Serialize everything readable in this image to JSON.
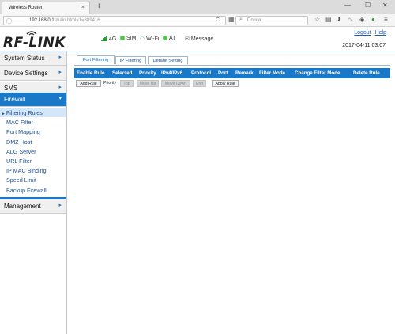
{
  "browser": {
    "tab_title": "Wireless Router",
    "tab_close": "×",
    "new_tab": "+",
    "win_min": "—",
    "win_max": "☐",
    "win_close": "✕",
    "url_host": "192.168.0.1",
    "url_rest": "/main.html#1=389416",
    "reload": "C",
    "search_placeholder": "Пошук",
    "icons": [
      "star-icon",
      "reading-list-icon",
      "download-icon",
      "home-icon",
      "pocket-icon",
      "extension-icon",
      "menu-icon"
    ]
  },
  "header": {
    "logo": "RF-LINK",
    "status": {
      "net": "4G",
      "sim": "SIM",
      "wifi": "Wi-Fi",
      "at": "AT",
      "message": "Message"
    },
    "links": {
      "logout": "Logout",
      "help": "Help"
    },
    "datetime": "2017-04-11 03:07",
    "colors": {
      "accent": "#1a78c8",
      "status_green": "#4cc94c"
    }
  },
  "sidebar": {
    "menus": [
      {
        "label": "System Status"
      },
      {
        "label": "Device Settings"
      },
      {
        "label": "SMS"
      },
      {
        "label": "Firewall"
      },
      {
        "label": "Management"
      }
    ],
    "arrow_right": "▸",
    "arrow_down": "▾",
    "sub_arrow": "▶",
    "firewall_items": [
      "Filtering Rules",
      "MAC Filter",
      "Port Mapping",
      "DMZ Host",
      "ALG Server",
      "URL Filter",
      "IP MAC Binding",
      "Speed Limit",
      "Backup Firewall"
    ],
    "selected_item": "Filtering Rules"
  },
  "content": {
    "tabs": [
      "Port Filtering",
      "IP Filtering",
      "Default Setting"
    ],
    "active_tab": "Port Filtering",
    "columns": [
      "Enable Rule",
      "Selected",
      "Priority",
      "IPv4/IPv6",
      "Protocol",
      "Port",
      "Remark",
      "Filter Mode",
      "Change Filter Mode",
      "Delete Rule"
    ],
    "buttons": {
      "add_rule": "Add Rule",
      "priority_label": "Priority",
      "top": "Top",
      "move_up": "Move Up",
      "move_down": "Move Down",
      "end": "End",
      "apply_rule": "Apply Rule"
    }
  }
}
